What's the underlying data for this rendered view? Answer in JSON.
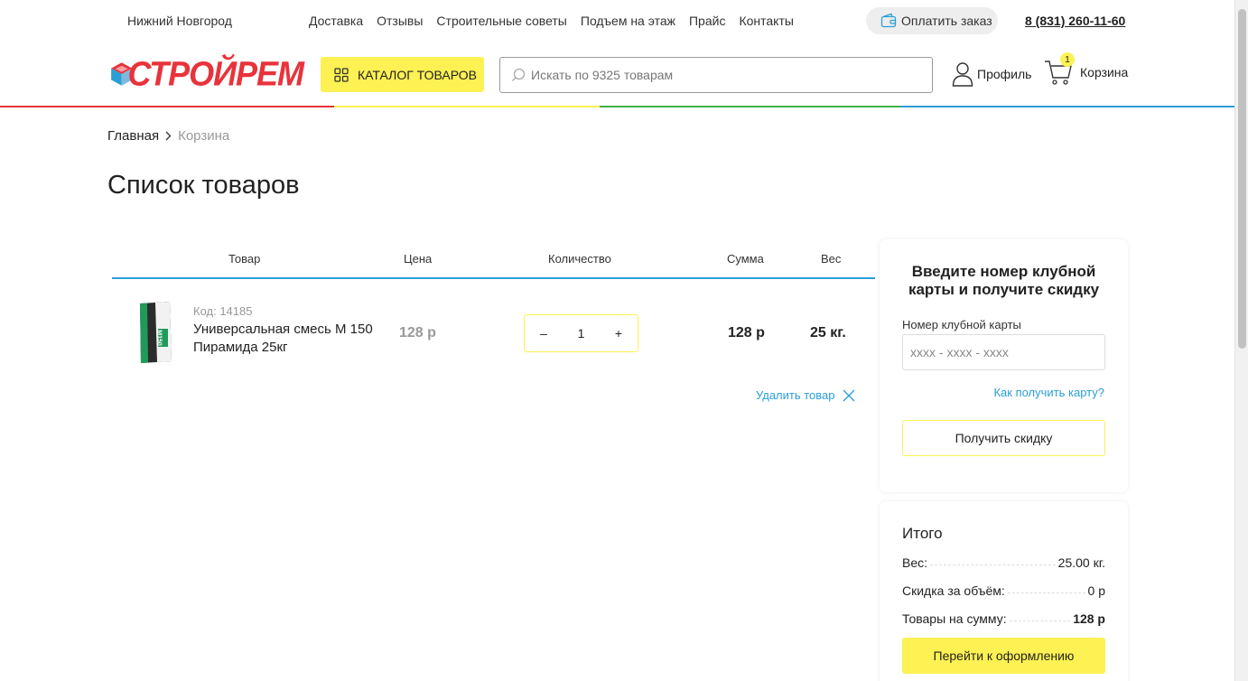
{
  "topbar": {
    "city": "Нижний Новгород",
    "nav": [
      "Доставка",
      "Отзывы",
      "Строительные советы",
      "Подъем на этаж",
      "Прайс",
      "Контакты"
    ],
    "pay_label": "Оплатить заказ",
    "phone": "8 (831) 260-11-60"
  },
  "header": {
    "logo_text": "СТРОЙРЕМ",
    "catalog_label": "КАТАЛОГ ТОВАРОВ",
    "search_placeholder": "Искать по 9325 товарам",
    "profile_label": "Профиль",
    "cart_label": "Корзина",
    "cart_count": "1"
  },
  "breadcrumb": {
    "home": "Главная",
    "current": "Корзина"
  },
  "page_title": "Список товаров",
  "table": {
    "headers": {
      "product": "Товар",
      "price": "Цена",
      "qty": "Количество",
      "sum": "Сумма",
      "weight": "Вес"
    },
    "rows": [
      {
        "code": "Код: 14185",
        "name": "Универсальная смесь М 150 Пирамида 25кг",
        "price": "128 р",
        "qty": "1",
        "sum": "128 р",
        "weight": "25 кг."
      }
    ],
    "qty_minus": "–",
    "qty_plus": "+",
    "remove_label": "Удалить товар"
  },
  "club_card": {
    "title": "Введите номер клубной карты и получите скидку",
    "field_label": "Номер клубной карты",
    "field_placeholder": "xxxx - xxxx - xxxx",
    "how_link": "Как получить карту?",
    "button": "Получить скидку"
  },
  "total": {
    "title": "Итого",
    "weight_label": "Вес:",
    "weight_value": "25.00 кг.",
    "discount_label": "Скидка за объём:",
    "discount_value": "0 р",
    "sum_label": "Товары на сумму:",
    "sum_value": "128 р",
    "checkout": "Перейти к оформлению"
  },
  "colors": {
    "accent_yellow": "#fdf153",
    "accent_blue": "#2a9fd6",
    "brand_red": "#e8333b",
    "line_colors": [
      "#e8333b",
      "#fdf153",
      "#3cb44b",
      "#2a9fd6"
    ]
  }
}
